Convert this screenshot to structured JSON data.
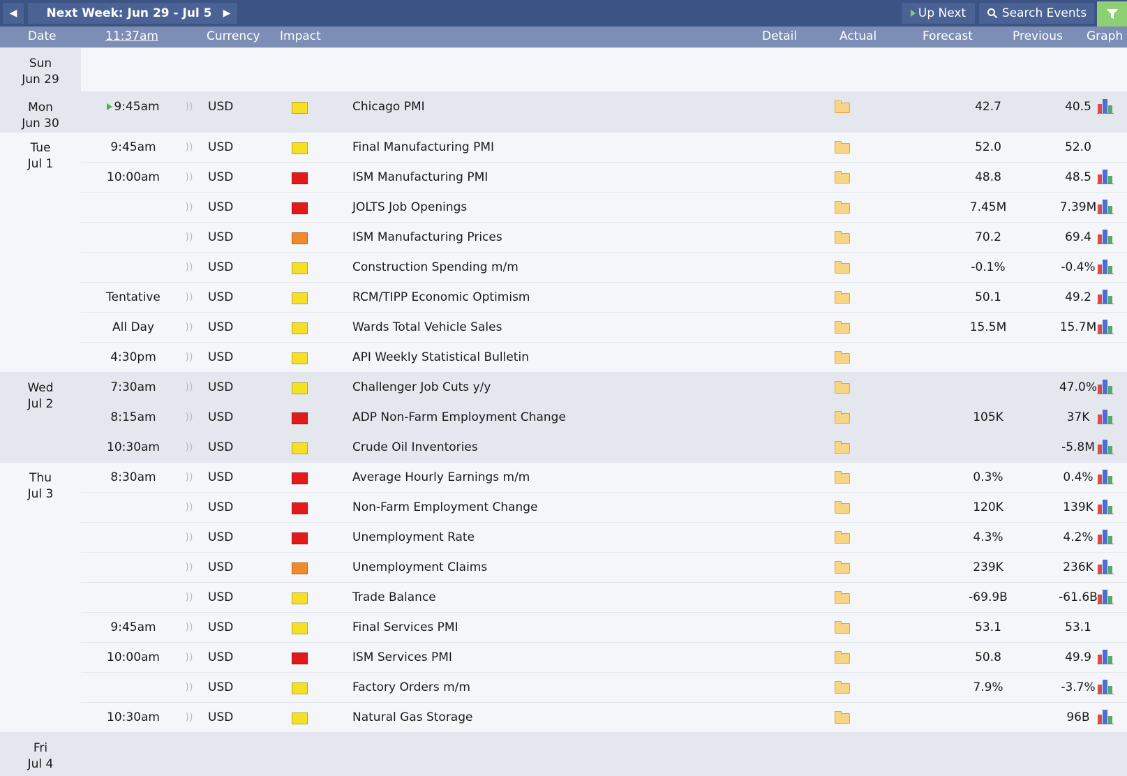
{
  "toolbar": {
    "prev_icon": "caret-left-icon",
    "week_label": "Next Week: Jun 29 - Jul 5",
    "next_icon": "caret-right-icon",
    "up_next_label": "Up Next",
    "search_label": "Search Events",
    "filter_icon": "filter-icon"
  },
  "columns": {
    "date": "Date",
    "time": "11:37am",
    "currency": "Currency",
    "impact": "Impact",
    "detail": "Detail",
    "actual": "Actual",
    "forecast": "Forecast",
    "previous": "Previous",
    "graph": "Graph"
  },
  "impact_colors": {
    "high": "#e21a1a",
    "medium": "#f08a2a",
    "low": "#f5e025"
  },
  "days": [
    {
      "weekday": "Sun",
      "date": "Jun 29",
      "events": []
    },
    {
      "weekday": "Mon",
      "date": "Jun 30",
      "events": [
        {
          "time": "9:45am",
          "currency": "USD",
          "impact": "low",
          "event": "Chicago PMI",
          "forecast": "42.7",
          "previous": "40.5",
          "graph": true,
          "current": true
        }
      ]
    },
    {
      "weekday": "Tue",
      "date": "Jul 1",
      "events": [
        {
          "time": "9:45am",
          "currency": "USD",
          "impact": "low",
          "event": "Final Manufacturing PMI",
          "forecast": "52.0",
          "previous": "52.0",
          "graph": false
        },
        {
          "time": "10:00am",
          "currency": "USD",
          "impact": "high",
          "event": "ISM Manufacturing PMI",
          "forecast": "48.8",
          "previous": "48.5",
          "graph": true
        },
        {
          "time": "",
          "currency": "USD",
          "impact": "high",
          "event": "JOLTS Job Openings",
          "forecast": "7.45M",
          "previous": "7.39M",
          "graph": true
        },
        {
          "time": "",
          "currency": "USD",
          "impact": "medium",
          "event": "ISM Manufacturing Prices",
          "forecast": "70.2",
          "previous": "69.4",
          "graph": true
        },
        {
          "time": "",
          "currency": "USD",
          "impact": "low",
          "event": "Construction Spending m/m",
          "forecast": "-0.1%",
          "previous": "-0.4%",
          "graph": true
        },
        {
          "time": "Tentative",
          "currency": "USD",
          "impact": "low",
          "event": "RCM/TIPP Economic Optimism",
          "forecast": "50.1",
          "previous": "49.2",
          "graph": true
        },
        {
          "time": "All Day",
          "currency": "USD",
          "impact": "low",
          "event": "Wards Total Vehicle Sales",
          "forecast": "15.5M",
          "previous": "15.7M",
          "graph": true
        },
        {
          "time": "4:30pm",
          "currency": "USD",
          "impact": "low",
          "event": "API Weekly Statistical Bulletin",
          "forecast": "",
          "previous": "",
          "graph": false
        }
      ]
    },
    {
      "weekday": "Wed",
      "date": "Jul 2",
      "events": [
        {
          "time": "7:30am",
          "currency": "USD",
          "impact": "low",
          "event": "Challenger Job Cuts y/y",
          "forecast": "",
          "previous": "47.0%",
          "graph": true
        },
        {
          "time": "8:15am",
          "currency": "USD",
          "impact": "high",
          "event": "ADP Non-Farm Employment Change",
          "forecast": "105K",
          "previous": "37K",
          "graph": true
        },
        {
          "time": "10:30am",
          "currency": "USD",
          "impact": "low",
          "event": "Crude Oil Inventories",
          "forecast": "",
          "previous": "-5.8M",
          "graph": true
        }
      ]
    },
    {
      "weekday": "Thu",
      "date": "Jul 3",
      "events": [
        {
          "time": "8:30am",
          "currency": "USD",
          "impact": "high",
          "event": "Average Hourly Earnings m/m",
          "forecast": "0.3%",
          "previous": "0.4%",
          "graph": true
        },
        {
          "time": "",
          "currency": "USD",
          "impact": "high",
          "event": "Non-Farm Employment Change",
          "forecast": "120K",
          "previous": "139K",
          "graph": true
        },
        {
          "time": "",
          "currency": "USD",
          "impact": "high",
          "event": "Unemployment Rate",
          "forecast": "4.3%",
          "previous": "4.2%",
          "graph": true
        },
        {
          "time": "",
          "currency": "USD",
          "impact": "medium",
          "event": "Unemployment Claims",
          "forecast": "239K",
          "previous": "236K",
          "graph": true
        },
        {
          "time": "",
          "currency": "USD",
          "impact": "low",
          "event": "Trade Balance",
          "forecast": "-69.9B",
          "previous": "-61.6B",
          "graph": true
        },
        {
          "time": "9:45am",
          "currency": "USD",
          "impact": "low",
          "event": "Final Services PMI",
          "forecast": "53.1",
          "previous": "53.1",
          "graph": false
        },
        {
          "time": "10:00am",
          "currency": "USD",
          "impact": "high",
          "event": "ISM Services PMI",
          "forecast": "50.8",
          "previous": "49.9",
          "graph": true
        },
        {
          "time": "",
          "currency": "USD",
          "impact": "low",
          "event": "Factory Orders m/m",
          "forecast": "7.9%",
          "previous": "-3.7%",
          "graph": true
        },
        {
          "time": "10:30am",
          "currency": "USD",
          "impact": "low",
          "event": "Natural Gas Storage",
          "forecast": "",
          "previous": "96B",
          "graph": true
        }
      ]
    },
    {
      "weekday": "Fri",
      "date": "Jul 4",
      "events": []
    }
  ]
}
